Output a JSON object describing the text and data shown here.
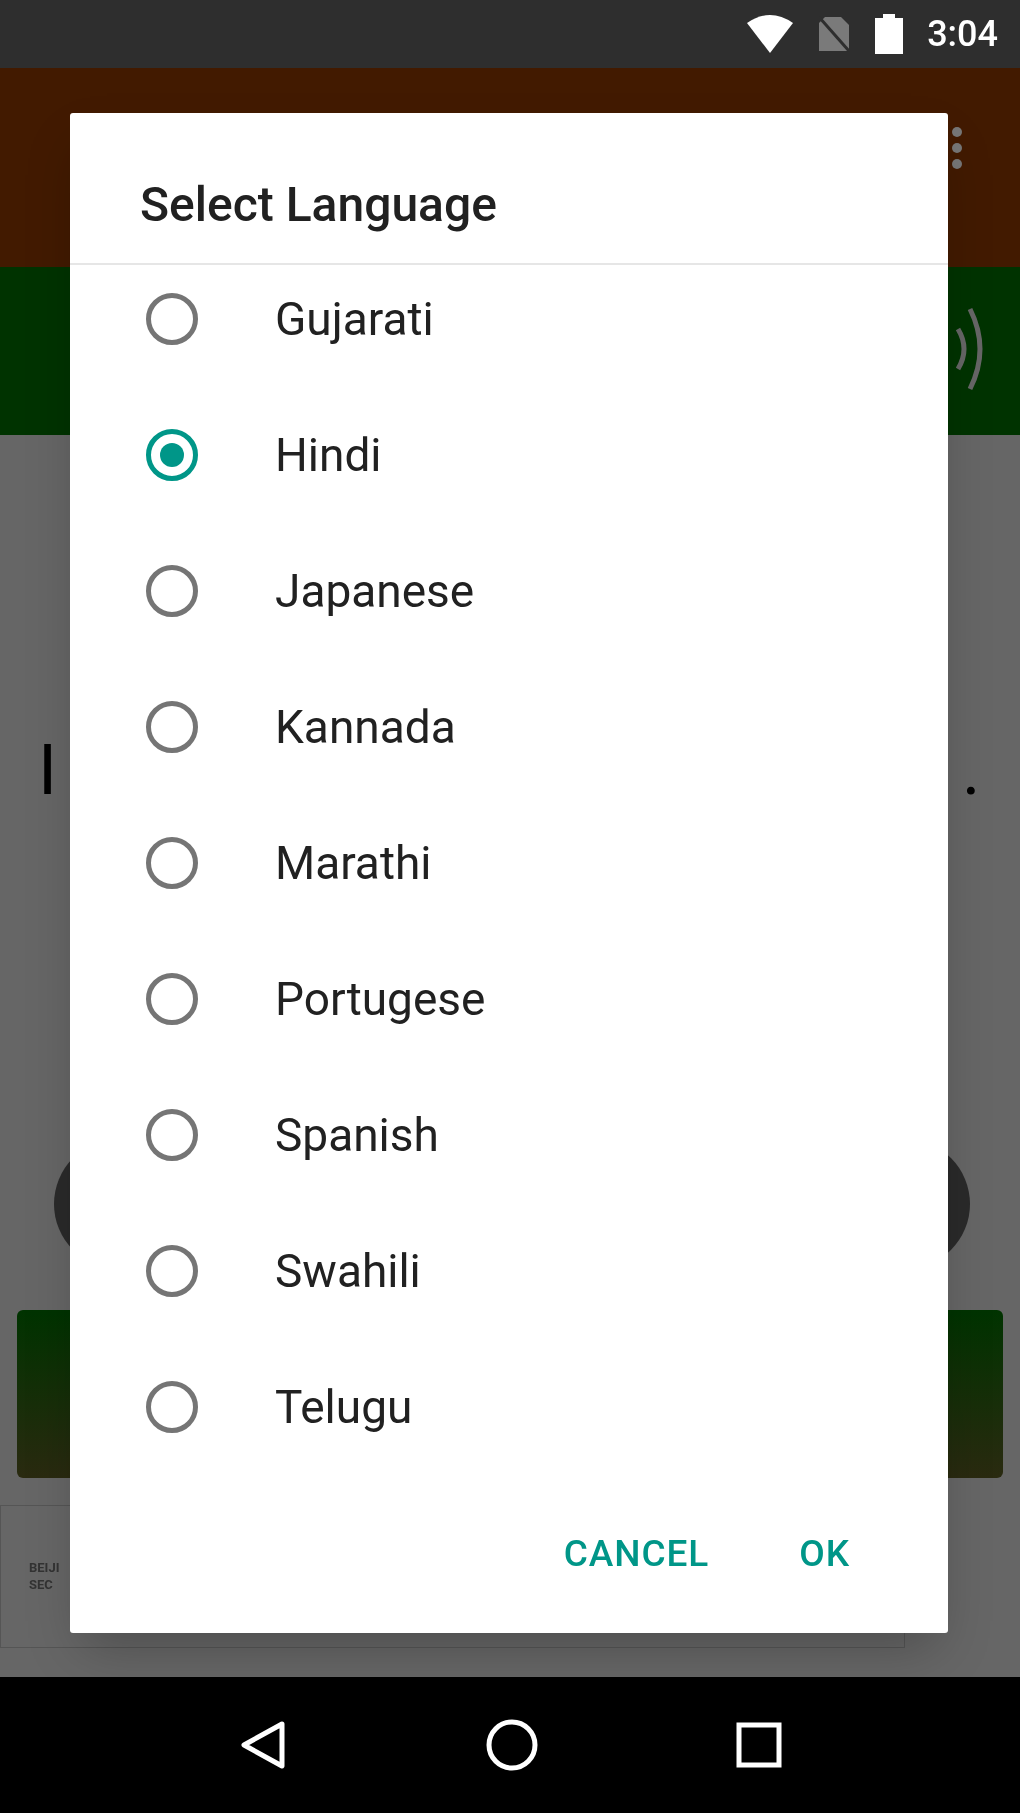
{
  "status_bar": {
    "time": "3:04"
  },
  "background": {
    "text_start": "I",
    "text_end": ".",
    "ad_lines": [
      "BEIJI",
      "SEC"
    ]
  },
  "dialog": {
    "title": "Select Language",
    "options": [
      {
        "label": "Gujarati",
        "selected": false
      },
      {
        "label": "Hindi",
        "selected": true
      },
      {
        "label": "Japanese",
        "selected": false
      },
      {
        "label": "Kannada",
        "selected": false
      },
      {
        "label": "Marathi",
        "selected": false
      },
      {
        "label": "Portugese",
        "selected": false
      },
      {
        "label": "Spanish",
        "selected": false
      },
      {
        "label": "Swahili",
        "selected": false
      },
      {
        "label": "Telugu",
        "selected": false
      }
    ],
    "buttons": [
      "CANCEL",
      "OK"
    ]
  }
}
